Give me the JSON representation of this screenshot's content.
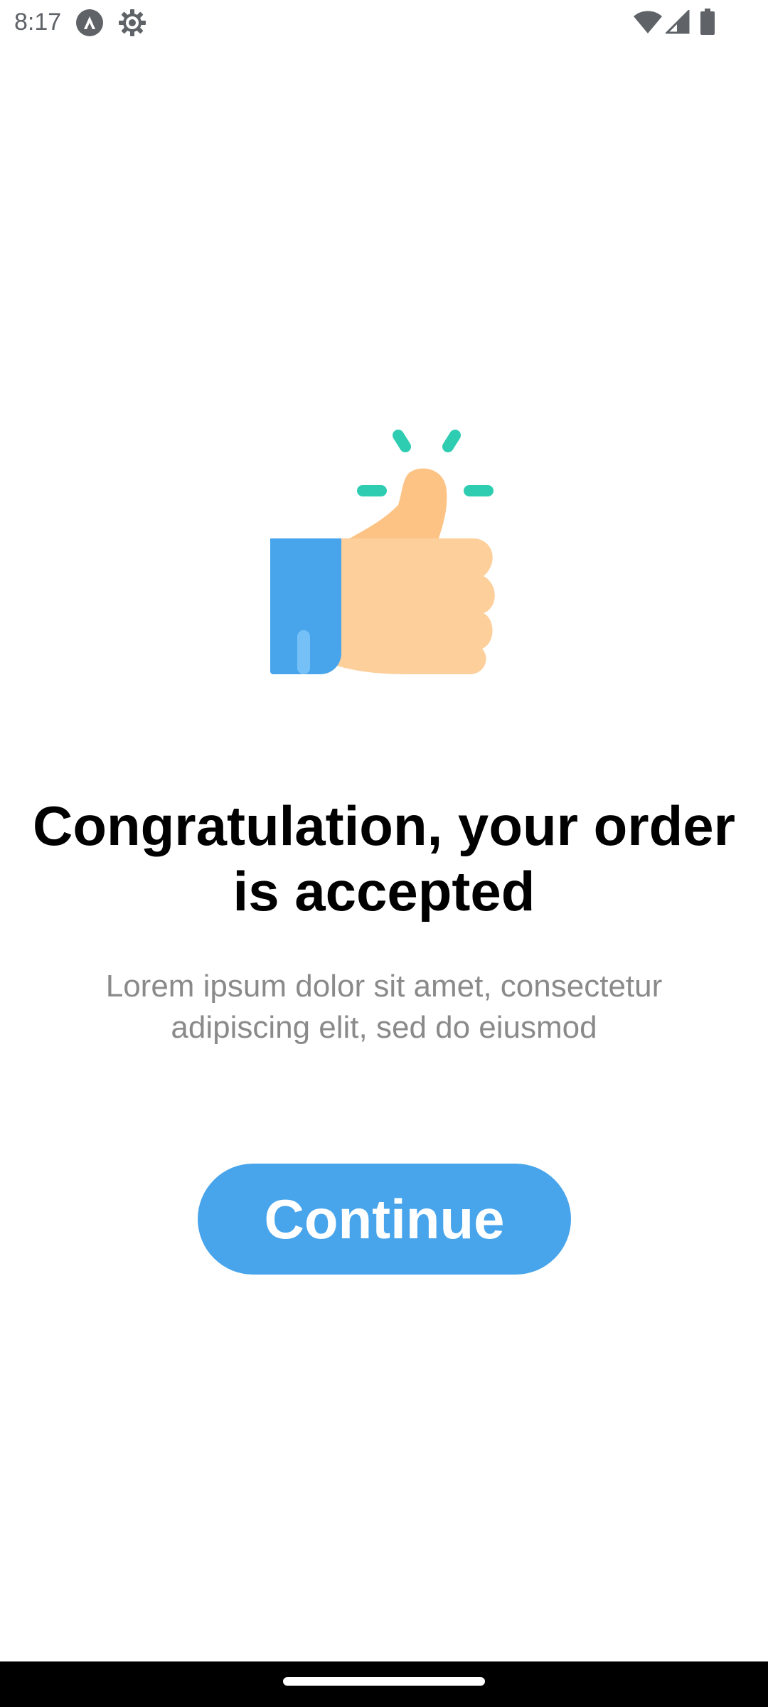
{
  "status_bar": {
    "time": "8:17",
    "icons": [
      "android-auto-icon",
      "settings-gear-icon",
      "wifi-icon",
      "cellular-signal-icon",
      "battery-icon"
    ]
  },
  "illustration": {
    "icon": "thumbs-up-icon",
    "colors": {
      "sleeve": "#48a5eb",
      "sleeve_highlight": "#75c1f7",
      "hand": "#fdcf9b",
      "thumb": "#fdc384",
      "sparkles": "#2ecdb1"
    }
  },
  "main": {
    "title": "Congratulation, your order is accepted",
    "subtitle": "Lorem ipsum dolor sit amet, consectetur adipiscing elit, sed do eiusmod",
    "continue_label": "Continue"
  },
  "colors": {
    "accent": "#48a5eb",
    "title": "#000000",
    "subtitle": "#8a8a8a",
    "background": "#ffffff"
  }
}
